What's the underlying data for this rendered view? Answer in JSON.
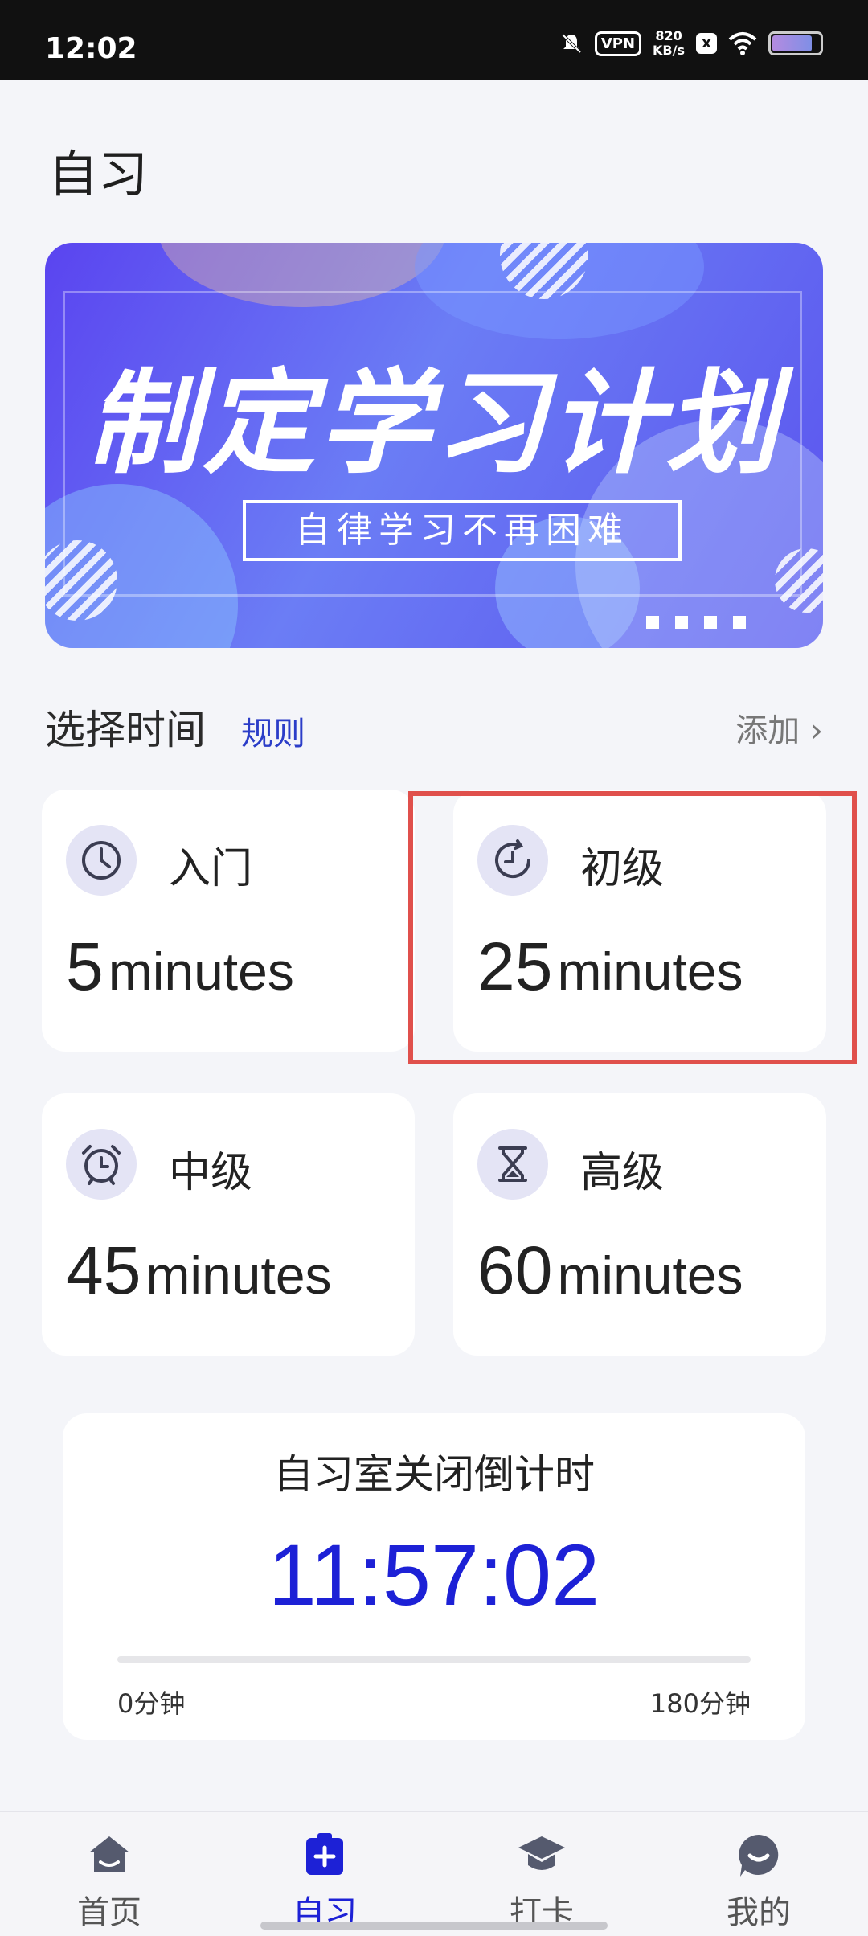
{
  "status_bar": {
    "time": "12:02",
    "vpn": "VPN",
    "speed_value": "820",
    "speed_unit": "KB/s",
    "x_badge": "x",
    "battery_level": 0.85
  },
  "page": {
    "title": "自习"
  },
  "banner": {
    "headline": "制定学习计划",
    "subtitle": "自律学习不再困难"
  },
  "section": {
    "title": "选择时间",
    "rules_link": "规则",
    "add_link": "添加 ›"
  },
  "cards": [
    {
      "label": "入门",
      "number": "5",
      "unit": "minutes",
      "icon": "clock-icon"
    },
    {
      "label": "初级",
      "number": "25",
      "unit": "minutes",
      "icon": "timer-icon"
    },
    {
      "label": "中级",
      "number": "45",
      "unit": "minutes",
      "icon": "alarm-clock-icon"
    },
    {
      "label": "高级",
      "number": "60",
      "unit": "minutes",
      "icon": "hourglass-icon"
    }
  ],
  "countdown": {
    "title": "自习室关闭倒计时",
    "time": "11:57:02",
    "min_label": "0分钟",
    "max_label": "180分钟",
    "progress": 0
  },
  "tabs": [
    {
      "label": "首页",
      "icon": "home-icon",
      "active": false
    },
    {
      "label": "自习",
      "icon": "study-clipboard-icon",
      "active": true
    },
    {
      "label": "打卡",
      "icon": "graduation-cap-icon",
      "active": false
    },
    {
      "label": "我的",
      "icon": "profile-smile-icon",
      "active": false
    }
  ],
  "colors": {
    "accent": "#1d21d6",
    "highlight_border": "#e0504c",
    "background": "#f4f5f9"
  }
}
